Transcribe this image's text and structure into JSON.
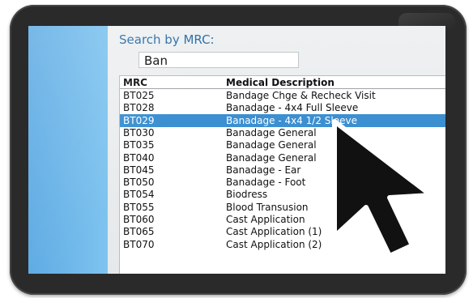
{
  "search": {
    "label": "Search by MRC:",
    "value": "Ban"
  },
  "table": {
    "columns": [
      "MRC",
      "Medical Description"
    ],
    "rows": [
      {
        "code": "BT025",
        "description": "Bandage Chge & Recheck Visit"
      },
      {
        "code": "BT028",
        "description": "Banadage - 4x4 Full Sleeve"
      },
      {
        "code": "BT029",
        "description": "Banadage - 4x4 1/2 Sleeve"
      },
      {
        "code": "BT030",
        "description": "Banadage General"
      },
      {
        "code": "BT035",
        "description": "Banadage General"
      },
      {
        "code": "BT040",
        "description": "Banadage General"
      },
      {
        "code": "BT045",
        "description": "Banadage - Ear"
      },
      {
        "code": "BT050",
        "description": "Banadage - Foot"
      },
      {
        "code": "BT054",
        "description": "Biodress"
      },
      {
        "code": "BT055",
        "description": "Blood Transusion"
      },
      {
        "code": "BT060",
        "description": "Cast Application"
      },
      {
        "code": "BT065",
        "description": "Cast Application (1)"
      },
      {
        "code": "BT070",
        "description": "Cast Application (2)"
      }
    ],
    "selected_index": 2
  },
  "colors": {
    "sidebar": "#6fb8ea",
    "selection": "#3c8fd0",
    "label": "#2b6ea8",
    "bezel": "#2a2a2a"
  },
  "icons": {
    "pointer": "arrow-cursor-icon"
  }
}
